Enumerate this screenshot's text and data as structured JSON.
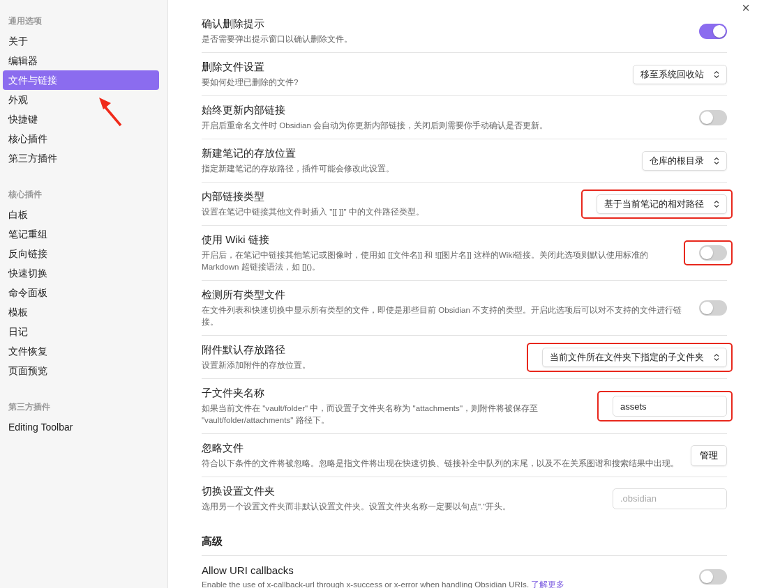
{
  "sidebar": {
    "sections": [
      {
        "heading": "通用选项",
        "items": [
          {
            "label": "关于",
            "selected": false
          },
          {
            "label": "编辑器",
            "selected": false
          },
          {
            "label": "文件与链接",
            "selected": true
          },
          {
            "label": "外观",
            "selected": false
          },
          {
            "label": "快捷键",
            "selected": false
          },
          {
            "label": "核心插件",
            "selected": false
          },
          {
            "label": "第三方插件",
            "selected": false
          }
        ]
      },
      {
        "heading": "核心插件",
        "items": [
          {
            "label": "白板",
            "selected": false
          },
          {
            "label": "笔记重组",
            "selected": false
          },
          {
            "label": "反向链接",
            "selected": false
          },
          {
            "label": "快速切换",
            "selected": false
          },
          {
            "label": "命令面板",
            "selected": false
          },
          {
            "label": "模板",
            "selected": false
          },
          {
            "label": "日记",
            "selected": false
          },
          {
            "label": "文件恢复",
            "selected": false
          },
          {
            "label": "页面预览",
            "selected": false
          }
        ]
      },
      {
        "heading": "第三方插件",
        "items": [
          {
            "label": "Editing Toolbar",
            "selected": false
          }
        ]
      }
    ]
  },
  "annotation_arrow": true,
  "close_button": "×",
  "settings": [
    {
      "kind": "toggle",
      "title": "确认删除提示",
      "description": "是否需要弹出提示窗口以确认删除文件。",
      "on": true,
      "highlighted": false
    },
    {
      "kind": "dropdown",
      "title": "删除文件设置",
      "description": "要如何处理已删除的文件?",
      "value": "移至系统回收站",
      "highlighted": false
    },
    {
      "kind": "toggle",
      "title": "始终更新内部链接",
      "description": "开启后重命名文件时 Obsidian 会自动为你更新内部链接，关闭后则需要你手动确认是否更新。",
      "on": false,
      "highlighted": false
    },
    {
      "kind": "dropdown",
      "title": "新建笔记的存放位置",
      "description": "指定新建笔记的存放路径，插件可能会修改此设置。",
      "value": "仓库的根目录",
      "highlighted": false
    },
    {
      "kind": "dropdown",
      "title": "内部链接类型",
      "description": "设置在笔记中链接其他文件时插入 \"[[ ]]\" 中的文件路径类型。",
      "value": "基于当前笔记的相对路径",
      "highlighted": true
    },
    {
      "kind": "toggle",
      "title": "使用 Wiki 链接",
      "description": "开启后，在笔记中链接其他笔记或图像时，使用如 [[文件名]] 和 ![[图片名]] 这样的Wiki链接。关闭此选项则默认使用标准的 Markdown 超链接语法，如 []()。",
      "on": false,
      "highlighted": true
    },
    {
      "kind": "toggle",
      "title": "检测所有类型文件",
      "description": "在文件列表和快速切换中显示所有类型的文件，即使是那些目前 Obsidian 不支持的类型。开启此选项后可以对不支持的文件进行链接。",
      "on": false,
      "highlighted": false
    },
    {
      "kind": "dropdown",
      "title": "附件默认存放路径",
      "description": "设置新添加附件的存放位置。",
      "value": "当前文件所在文件夹下指定的子文件夹",
      "highlighted": true
    },
    {
      "kind": "text",
      "title": "子文件夹名称",
      "description": "如果当前文件在 \"vault/folder\" 中，而设置子文件夹名称为 \"attachments\"，则附件将被保存至 \"vault/folder/attachments\" 路径下。",
      "value": "assets",
      "highlighted": true
    },
    {
      "kind": "button",
      "title": "忽略文件",
      "description": "符合以下条件的文件将被忽略。忽略是指文件将出现在快速切换、链接补全中队列的末尾，以及不在关系图谱和搜索结果中出现。",
      "button": "管理",
      "highlighted": false
    },
    {
      "kind": "text",
      "title": "切换设置文件夹",
      "description": "选用另一个设置文件夹而非默认设置文件夹。设置文件夹名称一定要以句点\".\"开头。",
      "placeholder": ".obsidian",
      "highlighted": false
    }
  ],
  "advanced": {
    "heading": "高级",
    "settings": [
      {
        "kind": "toggle",
        "title": "Allow URI callbacks",
        "description": "Enable the use of x-callback-url through x-success or x-error when handling Obsidian URIs.",
        "link": "了解更多",
        "on": false,
        "highlighted": false
      }
    ]
  }
}
